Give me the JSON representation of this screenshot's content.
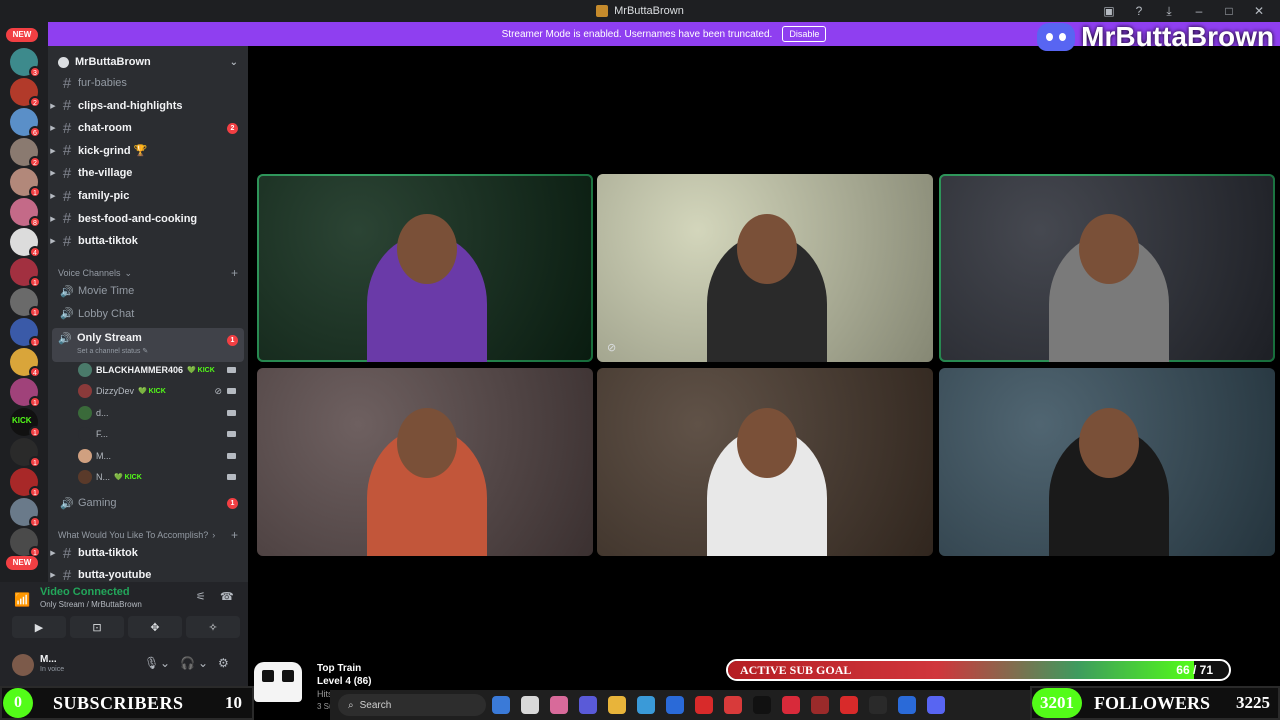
{
  "window": {
    "title": "MrButtaBrown",
    "controls": [
      "▣",
      "?",
      "⤓",
      "–",
      "□",
      "✕"
    ]
  },
  "banner": {
    "text": "Streamer Mode is enabled. Usernames have been truncated.",
    "disable_label": "Disable"
  },
  "brand": {
    "name": "MrButtaBrown"
  },
  "rail": {
    "new_top": "NEW",
    "new_bottom": "NEW",
    "servers": [
      {
        "color": "#3d8a8c",
        "badge": "3"
      },
      {
        "color": "#b23a2a",
        "badge": "2"
      },
      {
        "color": "#5a8fc8",
        "badge": "6"
      },
      {
        "color": "#8a7a70",
        "badge": "2"
      },
      {
        "color": "#b2887a",
        "badge": "1"
      },
      {
        "color": "#c46a88",
        "badge": "8"
      },
      {
        "color": "#dcdcdc",
        "badge": "4"
      },
      {
        "color": "#a23040",
        "badge": "1"
      },
      {
        "color": "#6a6a6a",
        "badge": "1"
      },
      {
        "color": "#3a5aa8",
        "badge": "1"
      },
      {
        "color": "#d9a53a",
        "badge": "4"
      },
      {
        "color": "#a0427a",
        "badge": "1"
      },
      {
        "color": "#111111",
        "badge": "1"
      },
      {
        "color": "#2a2a2a",
        "badge": "1"
      },
      {
        "color": "#a82828",
        "badge": "1"
      },
      {
        "color": "#6a7a8a",
        "badge": "1"
      },
      {
        "color": "#4a4a4a",
        "badge": "1"
      }
    ],
    "kick_text": "KICK"
  },
  "server": {
    "name": "MrButtaBrown"
  },
  "text_channels": [
    {
      "name": "fur-babies",
      "muted": true,
      "badge": ""
    },
    {
      "name": "clips-and-highlights",
      "muted": false,
      "badge": ""
    },
    {
      "name": "chat-room",
      "muted": false,
      "badge": "2"
    },
    {
      "name": "kick-grind 🏆",
      "muted": false,
      "badge": ""
    },
    {
      "name": "the-village",
      "muted": false,
      "badge": ""
    },
    {
      "name": "family-pic",
      "muted": false,
      "badge": ""
    },
    {
      "name": "best-food-and-cooking",
      "muted": false,
      "badge": ""
    },
    {
      "name": "butta-tiktok",
      "muted": false,
      "badge": ""
    }
  ],
  "voice_section_label": "Voice Channels",
  "voice_channels": [
    {
      "name": "Movie Time"
    },
    {
      "name": "Lobby Chat"
    }
  ],
  "only_stream": {
    "name": "Only Stream",
    "status": "Set a channel status ✎",
    "badge": "1"
  },
  "members": [
    {
      "name": "BLACKHAMMER406",
      "kick": "💚 KICK",
      "color": "#4a7a6a",
      "muted": false
    },
    {
      "name": "DizzyDev",
      "kick": "💚 KICK",
      "color": "#8a3a3a",
      "muted": true
    },
    {
      "name": "d...",
      "kick": "",
      "color": "#3a6a3a",
      "muted": false
    },
    {
      "name": "F...",
      "kick": "",
      "color": "#2b2d31",
      "muted": false
    },
    {
      "name": "M...",
      "kick": "",
      "color": "#d0a080",
      "muted": false
    },
    {
      "name": "N...",
      "kick": "💚 KICK",
      "color": "#5a3a2a",
      "muted": false
    }
  ],
  "gaming": {
    "name": "Gaming",
    "badge": "1"
  },
  "accomplish_label": "What Would You Like To Accomplish?",
  "bottom_channels": [
    {
      "name": "butta-tiktok"
    },
    {
      "name": "butta-youtube"
    }
  ],
  "voice_panel": {
    "title": "Video Connected",
    "subtitle": "Only Stream / MrButtaBrown",
    "icons": [
      "⚟",
      "☎"
    ],
    "buttons": [
      "▶",
      "⊡",
      "✥",
      "✧"
    ]
  },
  "user_panel": {
    "name": "M...",
    "status": "In voice",
    "controls": [
      "🎙",
      "⌄",
      "🎧",
      "⌄",
      "⚙"
    ]
  },
  "tiles": [
    {
      "name": "tile-1",
      "bg": "#0e2a18",
      "person": "#6a3aa8",
      "speaking": true
    },
    {
      "name": "tile-2",
      "bg": "#cdd0b2",
      "person": "#2a2a2a",
      "speaking": false
    },
    {
      "name": "tile-3",
      "bg": "#2c2f38",
      "person": "#7a7a7a",
      "speaking": true
    },
    {
      "name": "tile-4",
      "bg": "#5a4a4a",
      "person": "#c2563a",
      "speaking": false
    },
    {
      "name": "tile-5",
      "bg": "#4a3a2e",
      "person": "#e8e8e8",
      "speaking": false
    },
    {
      "name": "tile-6",
      "bg": "#38505e",
      "person": "#1a1a1a",
      "speaking": false
    }
  ],
  "subscribers": {
    "current": "0",
    "label": "SUBSCRIBERS",
    "goal": "10"
  },
  "top_train": {
    "title": "Top Train",
    "level": "Level 4  (86)",
    "hits": "Hits 7 / 7",
    "subs": "3 Subs"
  },
  "sub_goal": {
    "label": "ACTIVE SUB GOAL",
    "value": "66 / 71",
    "progress": 0.93
  },
  "taskbar": {
    "search_placeholder": "Search",
    "apps": [
      "#3a7ad8",
      "#d8d8d8",
      "#d86a9a",
      "#5a5ad8",
      "#e8b43a",
      "#3a9ad8",
      "#2a6ad8",
      "#d82a2a",
      "#d83a3a",
      "#111111",
      "#d82a3a",
      "#9a2a2a",
      "#d82a2a",
      "#2a2a2a",
      "#2a6ad8",
      "#5865f2"
    ]
  },
  "followers": {
    "current": "3201",
    "label": "FOLLOWERS",
    "goal": "3225"
  }
}
